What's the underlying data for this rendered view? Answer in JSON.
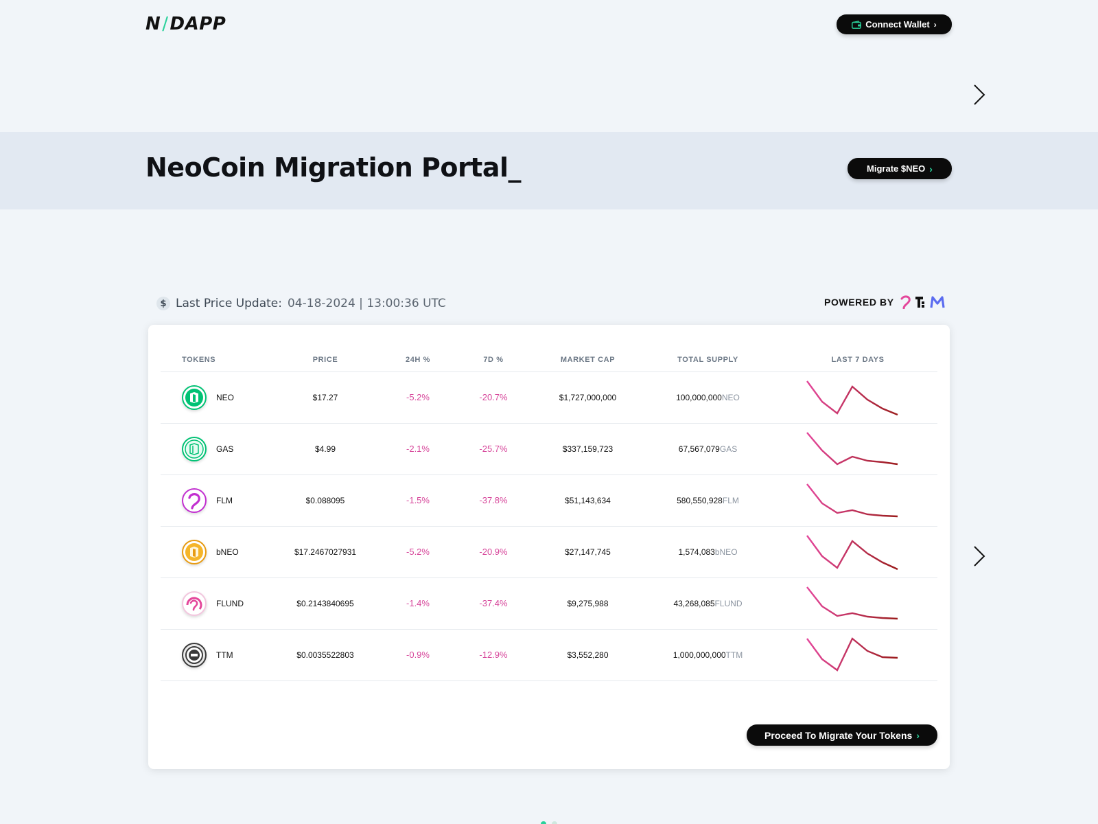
{
  "header": {
    "logo_left": "N",
    "logo_slash": "/",
    "logo_right": "DAPP",
    "connect_label": "Connect Wallet"
  },
  "banner": {
    "title": "NeoCoin Migration Portal_",
    "migrate_label": "Migrate $NEO"
  },
  "price_update": {
    "label": "Last Price Update:",
    "value": "04-18-2024 | 13:00:36 UTC"
  },
  "powered": {
    "label": "POWERED BY"
  },
  "table": {
    "headers": [
      "TOKENS",
      "PRICE",
      "24H %",
      "7D %",
      "MARKET CAP",
      "TOTAL SUPPLY",
      "LAST 7 DAYS"
    ],
    "rows": [
      {
        "token": "NEO",
        "price": "$17.27",
        "change_24h": "-5.2%",
        "change_7d": "-20.7%",
        "market_cap": "$1,727,000,000",
        "supply": "100,000,000",
        "unit": "NEO",
        "icon": "neo-icon",
        "color": "#00c274"
      },
      {
        "token": "GAS",
        "price": "$4.99",
        "change_24h": "-2.1%",
        "change_7d": "-25.7%",
        "market_cap": "$337,159,723",
        "supply": "67,567,079",
        "unit": "GAS",
        "icon": "gas-icon",
        "color": "#00c274"
      },
      {
        "token": "FLM",
        "price": "$0.088095",
        "change_24h": "-1.5%",
        "change_7d": "-37.8%",
        "market_cap": "$51,143,634",
        "supply": "580,550,928",
        "unit": "FLM",
        "icon": "flm-icon",
        "color": "#c22fd0"
      },
      {
        "token": "bNEO",
        "price": "$17.2467027931",
        "change_24h": "-5.2%",
        "change_7d": "-20.9%",
        "market_cap": "$27,147,745",
        "supply": "1,574,083",
        "unit": "bNEO",
        "icon": "bneo-icon",
        "color": "#e79b12"
      },
      {
        "token": "FLUND",
        "price": "$0.2143840695",
        "change_24h": "-1.4%",
        "change_7d": "-37.4%",
        "market_cap": "$9,275,988",
        "supply": "43,268,085",
        "unit": "FLUND",
        "icon": "flund-icon",
        "color": "#e4479b"
      },
      {
        "token": "TTM",
        "price": "$0.0035522803",
        "change_24h": "-0.9%",
        "change_7d": "-12.9%",
        "market_cap": "$3,552,280",
        "supply": "1,000,000,000",
        "unit": "TTM",
        "icon": "ttm-icon",
        "color": "#3a3a3a"
      }
    ]
  },
  "proceed_label": "Proceed To Migrate Your Tokens",
  "colors": {
    "accent": "#2ad19b",
    "negative": "#d7479b",
    "spark_start": "#e4479b",
    "spark_end": "#9b1c1c"
  }
}
